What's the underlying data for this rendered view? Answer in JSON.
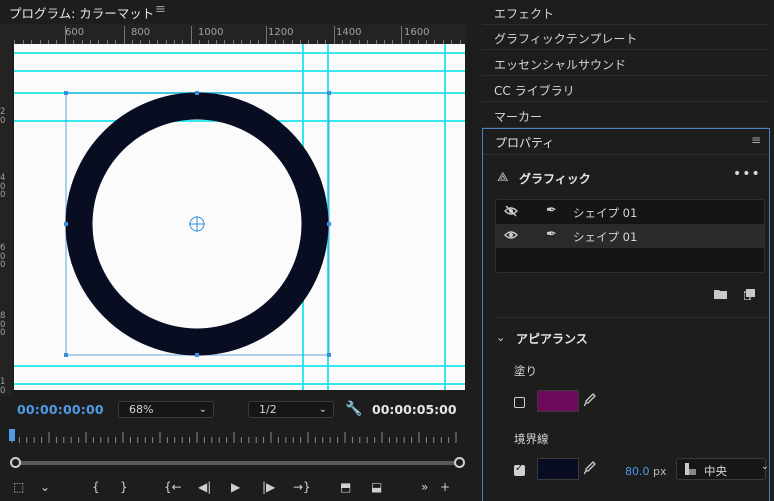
{
  "monitor": {
    "title": "プログラム: カラーマット",
    "menu_icon": "hamburger-icon",
    "ruler_top_labels": [
      "600",
      "800",
      "1000",
      "1200",
      "1400",
      "1600"
    ],
    "ruler_left_labels": [
      "2\n0",
      "4\n0\n0",
      "6\n0\n0",
      "8\n0\n0",
      "1\n0"
    ],
    "current_timecode": "00:00:00:00",
    "zoom": "68%",
    "resolution": "1/2",
    "duration_timecode": "00:00:05:00",
    "colors": {
      "guide": "#19e6ec",
      "ring": "#080d22",
      "bbox": "#3a8fd8",
      "timecode": "#4f9be8"
    }
  },
  "controls": {
    "icons": [
      "crop-marker-icon",
      "chevron-down-icon",
      "mark-in-icon",
      "mark-out-icon",
      "go-to-in-icon",
      "step-back-icon",
      "play-icon",
      "step-forward-icon",
      "go-to-out-icon",
      "lift-icon",
      "extract-icon",
      "more-icon",
      "add-icon"
    ],
    "glyphs": [
      "⬚",
      "⌄",
      "{",
      "}",
      "{←",
      "◀|",
      "▶",
      "|▶",
      "→}",
      "⬒",
      "⬓",
      "»",
      "+"
    ]
  },
  "right_panels": {
    "tabs": [
      "エフェクト",
      "グラフィックテンプレート",
      "エッセンシャルサウンド",
      "CC ライブラリ",
      "マーカー"
    ]
  },
  "properties": {
    "title": "プロパティ",
    "graphic_title": "グラフィック",
    "more": "•••",
    "layers": [
      {
        "name": "シェイプ 01",
        "visible": false
      },
      {
        "name": "シェイプ 01",
        "visible": true
      }
    ],
    "appearance_title": "アピアランス",
    "fill_label": "塗り",
    "fill_enabled": false,
    "fill_color": "#6e0a5a",
    "stroke_label": "境界線",
    "stroke_enabled": true,
    "stroke_color": "#080d22",
    "stroke_width": "80.0",
    "stroke_unit": "px",
    "stroke_position": "中央"
  }
}
